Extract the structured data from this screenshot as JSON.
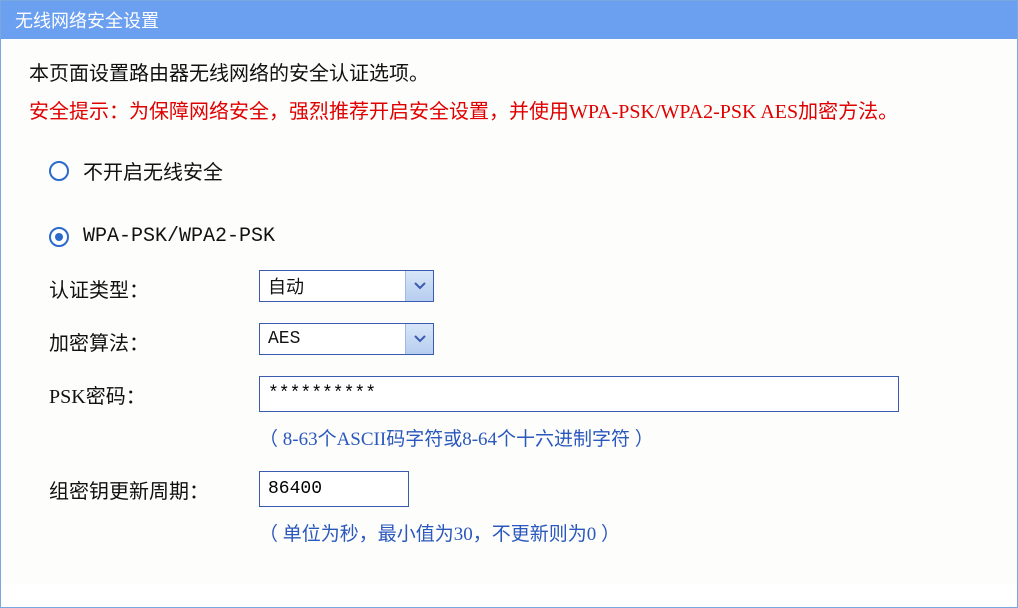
{
  "header": {
    "title": "无线网络安全设置"
  },
  "intro": "本页面设置路由器无线网络的安全认证选项。",
  "warning": "安全提示：为保障网络安全，强烈推荐开启安全设置，并使用WPA-PSK/WPA2-PSK AES加密方法。",
  "options": {
    "disable_security": "不开启无线安全",
    "wpa_psk": "WPA-PSK/WPA2-PSK"
  },
  "form": {
    "auth_type": {
      "label": "认证类型：",
      "value": "自动"
    },
    "encryption": {
      "label": "加密算法：",
      "value": "AES"
    },
    "psk": {
      "label": "PSK密码：",
      "value": "**********",
      "hint": "（ 8-63个ASCII码字符或8-64个十六进制字符 ）"
    },
    "group_key": {
      "label": "组密钥更新周期：",
      "value": "86400",
      "hint": "（ 单位为秒，最小值为30，不更新则为0 ）"
    }
  }
}
